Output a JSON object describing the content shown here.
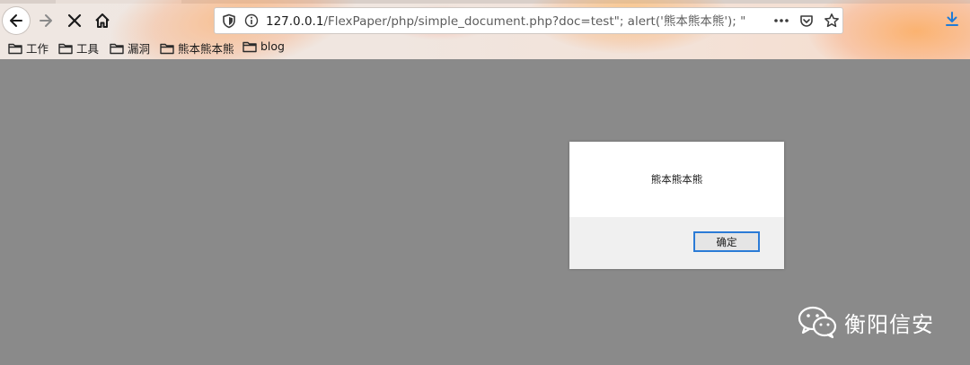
{
  "browser": {
    "url_host": "127.0.0.1",
    "url_rest": "/FlexPaper/php/simple_document.php?doc=test\"; alert('熊本熊本熊'); \"",
    "page_actions_icon": "more-dots-icon",
    "colors": {
      "content_bg": "#8a8a8a",
      "accent_blue": "#2b7bd6"
    }
  },
  "bookmarks": [
    {
      "label": "工作",
      "icon": "folder-icon"
    },
    {
      "label": "工具",
      "icon": "folder-icon"
    },
    {
      "label": "漏洞",
      "icon": "folder-icon"
    },
    {
      "label": "熊本熊本熊",
      "icon": "folder-icon"
    },
    {
      "label": "blog",
      "icon": "folder-icon"
    }
  ],
  "dialog": {
    "message": "熊本熊本熊",
    "ok_label": "确定"
  },
  "watermark": {
    "text": "衡阳信安",
    "icon": "wechat-icon"
  }
}
